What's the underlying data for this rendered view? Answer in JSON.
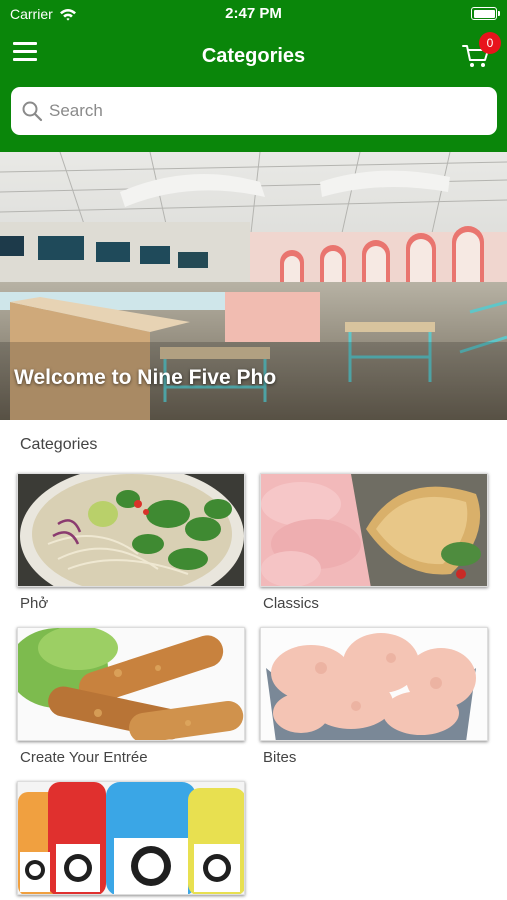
{
  "status_bar": {
    "carrier": "Carrier",
    "time": "2:47 PM"
  },
  "nav": {
    "title": "Categories",
    "cart_count": "0"
  },
  "search": {
    "placeholder": "Search"
  },
  "banner": {
    "title": "Welcome to Nine Five Pho"
  },
  "section": {
    "title": "Categories"
  },
  "categories": [
    {
      "label": "Phở",
      "image": "pho-bowl"
    },
    {
      "label": "Classics",
      "image": "banh-mi-sandwich"
    },
    {
      "label": "Create Your Entrée",
      "image": "spring-rolls"
    },
    {
      "label": "Bites",
      "image": "shrimp-chips"
    },
    {
      "label": "",
      "image": "gatorade-bottles"
    }
  ],
  "colors": {
    "header": "#0a860a",
    "badge": "#e8141c"
  }
}
